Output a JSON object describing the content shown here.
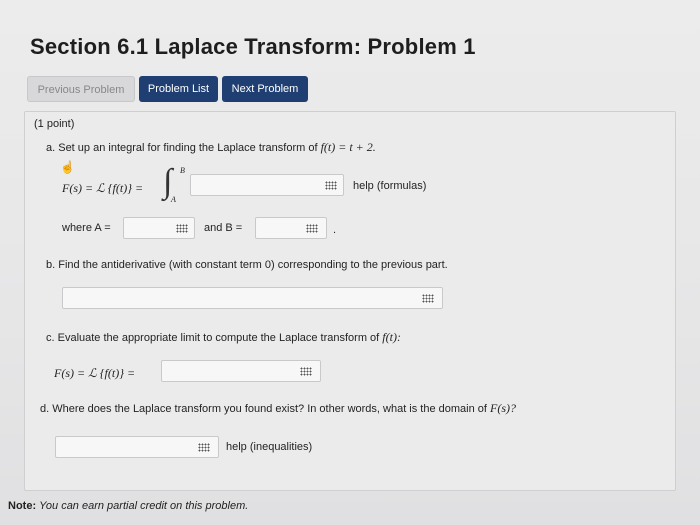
{
  "header": {
    "title": "Section 6.1 Laplace Transform: Problem 1"
  },
  "nav": {
    "prev_label": "Previous Problem",
    "list_label": "Problem List",
    "next_label": "Next Problem"
  },
  "problem": {
    "points": "(1 point)",
    "part_a": {
      "prompt": "a. Set up an integral for finding the Laplace transform of",
      "function": "f(t) = t + 2.",
      "lhs": "F(s) = ℒ {f(t)} =",
      "upper_limit": "B",
      "lower_limit": "A",
      "help": "help (formulas)",
      "where_a": "where A =",
      "and_b": "and B =",
      "period": "."
    },
    "part_b": {
      "prompt": "b. Find the antiderivative (with constant term 0) corresponding to the previous part."
    },
    "part_c": {
      "prompt": "c. Evaluate the appropriate limit to compute the Laplace transform of",
      "function": "f(t):",
      "lhs": "F(s) = ℒ {f(t)} ="
    },
    "part_d": {
      "prompt": "d. Where does the Laplace transform you found exist? In other words, what is the domain of",
      "function": "F(s)?",
      "help": "help (inequalities)"
    }
  },
  "footer": {
    "note_label": "Note:",
    "note_text": "You can earn partial credit on this problem."
  },
  "icons": {
    "equation_editor": "grid-icon",
    "cursor": "hand-pointer-icon"
  },
  "colors": {
    "primary_button": "#1f3f73",
    "disabled_button": "#d8d8da"
  }
}
